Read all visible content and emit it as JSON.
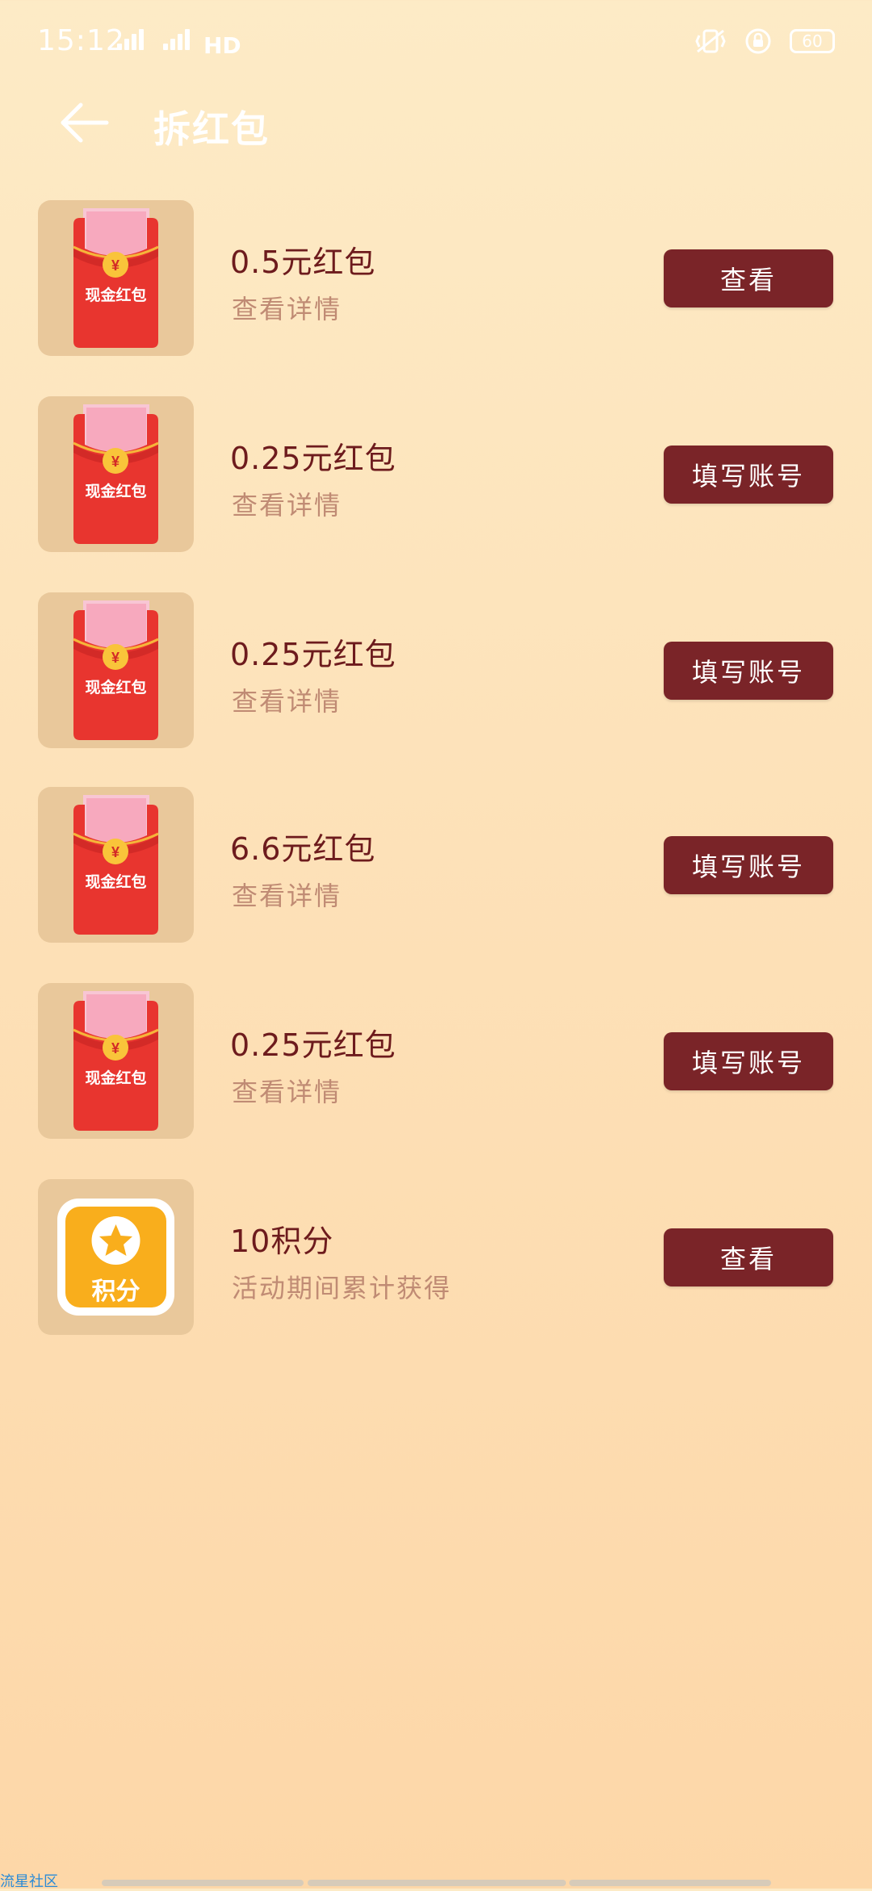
{
  "status_bar": {
    "time": "15:12",
    "network": "HD",
    "battery": "60"
  },
  "header": {
    "title": "拆红包"
  },
  "items": [
    {
      "title": "0.5元红包",
      "subtitle": "查看详情",
      "action": "查看",
      "thumb_label": "现金红包"
    },
    {
      "title": "0.25元红包",
      "subtitle": "查看详情",
      "action": "填写账号",
      "thumb_label": "现金红包"
    },
    {
      "title": "0.25元红包",
      "subtitle": "查看详情",
      "action": "填写账号",
      "thumb_label": "现金红包"
    },
    {
      "title": "6.6元红包",
      "subtitle": "查看详情",
      "action": "填写账号",
      "thumb_label": "现金红包"
    },
    {
      "title": "0.25元红包",
      "subtitle": "查看详情",
      "action": "填写账号",
      "thumb_label": "现金红包"
    },
    {
      "title": "10积分",
      "subtitle": "活动期间累计获得",
      "action": "查看",
      "thumb_label": "积分"
    }
  ],
  "footer": {
    "watermark": "流星社区"
  },
  "icons": {
    "back": "back-arrow-icon",
    "coin": "yuan-coin-icon",
    "star": "star-icon"
  },
  "colors": {
    "button": "#7a2428",
    "thumb_bg": "#e9c89b",
    "title": "#6d1b1d",
    "subtitle": "#c08b74"
  }
}
